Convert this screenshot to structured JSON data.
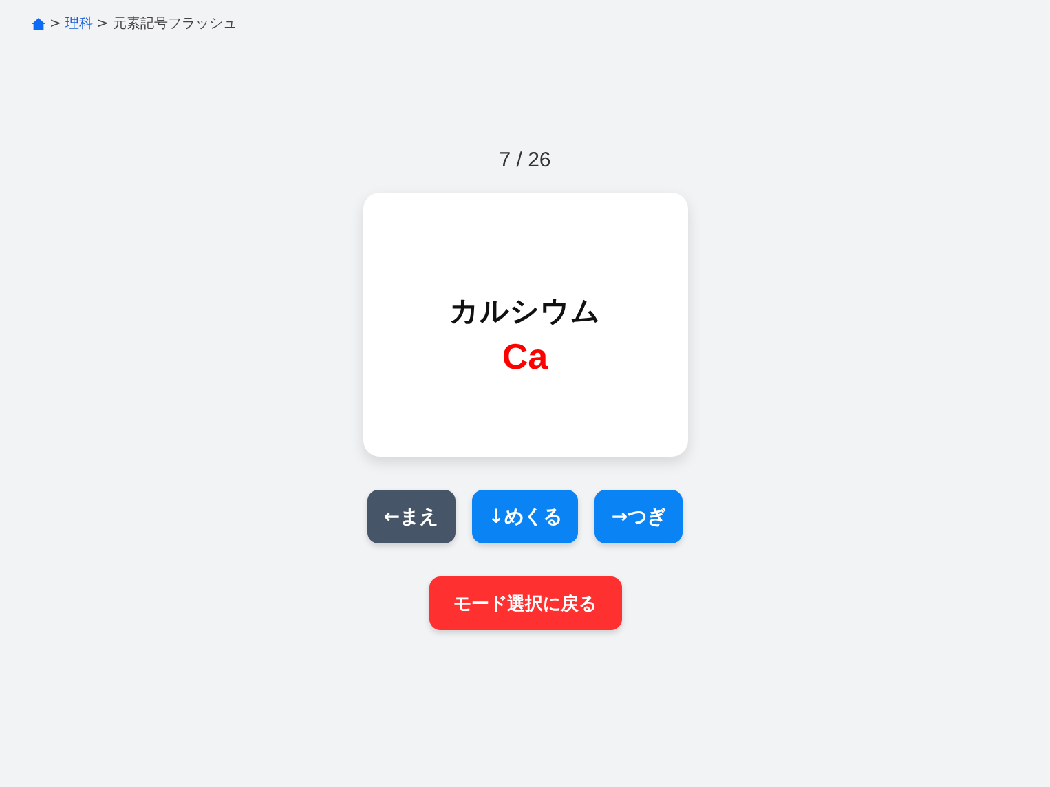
{
  "breadcrumb": {
    "items": [
      {
        "kind": "home"
      },
      {
        "kind": "link",
        "label": "理科"
      },
      {
        "kind": "current",
        "label": "元素記号フラッシュ"
      }
    ],
    "separator": ">"
  },
  "counter": "7 / 26",
  "card": {
    "name": "カルシウム",
    "symbol": "Ca"
  },
  "nav_buttons": [
    {
      "label": "←まえ",
      "color": "#475569"
    },
    {
      "label": "↓めくる",
      "color": "#0a84f4"
    },
    {
      "label": "→つぎ",
      "color": "#0a84f4"
    }
  ],
  "back_button": {
    "label": "モード選択に戻る",
    "color": "#ff3030"
  }
}
